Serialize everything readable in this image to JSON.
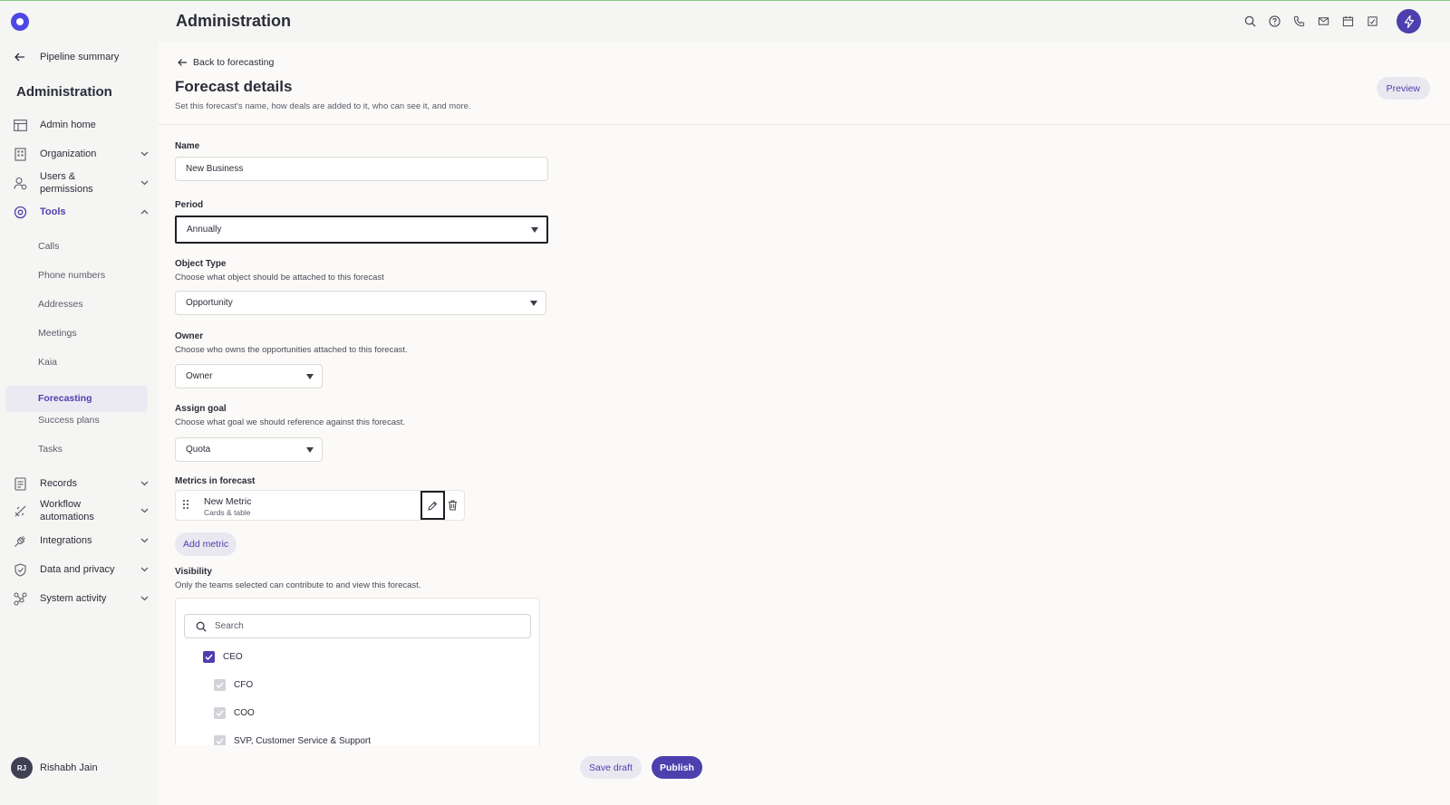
{
  "app": {
    "title": "Administration"
  },
  "top_icons": [
    "search-icon",
    "help-icon",
    "phone-icon",
    "mail-icon",
    "calendar-icon",
    "notes-icon",
    "bolt-icon"
  ],
  "sidebar": {
    "back_label": "Pipeline summary",
    "title": "Administration",
    "items": [
      {
        "label": "Admin home",
        "icon": "table-icon"
      },
      {
        "label": "Organization",
        "icon": "building-icon"
      },
      {
        "label": "Users &\npermissions",
        "icon": "users-icon"
      },
      {
        "label": "Tools",
        "icon": "tools-icon"
      },
      {
        "label": "Records",
        "icon": "records-icon"
      },
      {
        "label": "Workflow\nautomations",
        "icon": "workflow-icon"
      },
      {
        "label": "Integrations",
        "icon": "plug-icon"
      },
      {
        "label": "Data and privacy",
        "icon": "shield-icon"
      },
      {
        "label": "System activity",
        "icon": "activity-icon"
      }
    ],
    "tools_sub": [
      "Calls",
      "Phone numbers",
      "Addresses",
      "Meetings",
      "Kaia",
      "Forecasting",
      "Success plans",
      "Tasks"
    ],
    "active_sub": "Forecasting",
    "user": {
      "initials": "RJ",
      "name": "Rishabh Jain"
    }
  },
  "main": {
    "back_link": "Back to forecasting",
    "title": "Forecast details",
    "subtitle": "Set this forecast's name, how deals are added to it, who can see it, and more.",
    "preview_label": "Preview",
    "name": {
      "label": "Name",
      "value": "New Business"
    },
    "period": {
      "label": "Period",
      "value": "Annually"
    },
    "object_type": {
      "label": "Object Type",
      "hint": "Choose what object should be attached to this forecast",
      "value": "Opportunity"
    },
    "owner": {
      "label": "Owner",
      "hint": "Choose who owns the opportunities attached to this forecast.",
      "value": "Owner"
    },
    "goal": {
      "label": "Assign goal",
      "hint": "Choose what goal we should reference against this forecast.",
      "value": "Quota"
    },
    "metrics": {
      "label": "Metrics in forecast",
      "items": [
        {
          "name": "New Metric",
          "type": "Cards & table"
        }
      ],
      "add_label": "Add metric"
    },
    "visibility": {
      "label": "Visibility",
      "hint": "Only the teams selected can contribute to and view this forecast.",
      "search_placeholder": "Search",
      "teams": [
        {
          "name": "CEO",
          "checked": true
        },
        {
          "name": "CFO",
          "checked": true
        },
        {
          "name": "COO",
          "checked": true
        },
        {
          "name": "SVP, Customer Service & Support",
          "checked": true
        }
      ]
    }
  },
  "footer": {
    "save_draft": "Save draft",
    "publish": "Publish"
  },
  "colors": {
    "accent": "#4d3fae",
    "accent_light": "#e9e8f1",
    "background": "#fbfaf8",
    "sidebar": "#f5f5f3"
  }
}
